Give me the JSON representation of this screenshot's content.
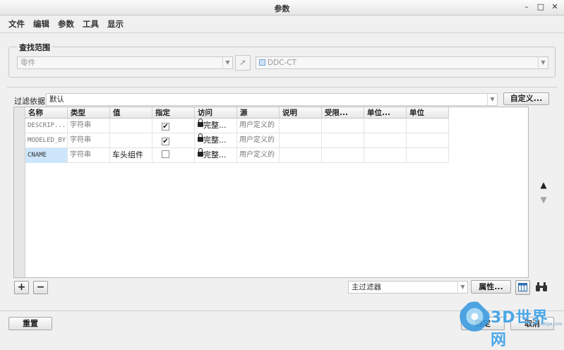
{
  "window": {
    "title": "参数",
    "minimize": "–",
    "maximize": "□",
    "close": "✕"
  },
  "menu": [
    "文件",
    "编辑",
    "参数",
    "工具",
    "显示"
  ],
  "scope": {
    "group_title": "查找范围",
    "type_value": "零件",
    "object_value": "DDC-CT"
  },
  "filter": {
    "label": "过滤依据",
    "value": "默认",
    "customize_button": "自定义..."
  },
  "table": {
    "columns": [
      "名称",
      "类型",
      "值",
      "指定",
      "访问",
      "源",
      "说明",
      "受限...",
      "单位...",
      "单位"
    ],
    "rows": [
      {
        "name": "DESCRIP...",
        "type": "字符串",
        "value": "",
        "designated": true,
        "access": "完整...",
        "source": "用户定义的",
        "selected": false
      },
      {
        "name": "MODELED_BY",
        "type": "字符串",
        "value": "",
        "designated": true,
        "access": "完整...",
        "source": "用户定义的",
        "selected": false
      },
      {
        "name": "CNAME",
        "type": "字符串",
        "value": "车头组件",
        "designated": false,
        "access": "完整...",
        "source": "用户定义的",
        "selected": true
      }
    ]
  },
  "bottom": {
    "add_label": "+",
    "remove_label": "−",
    "main_filter_value": "主过滤器",
    "properties_button": "属性...",
    "reset_button": "重置",
    "ok_label": "确定",
    "cancel_label": "取消"
  },
  "watermark": {
    "text": "3D世界网",
    "sub": "www.3dsjw.com"
  },
  "colors": {
    "selected_cell": "#cde6fb",
    "watermark": "#4aa6e6"
  }
}
